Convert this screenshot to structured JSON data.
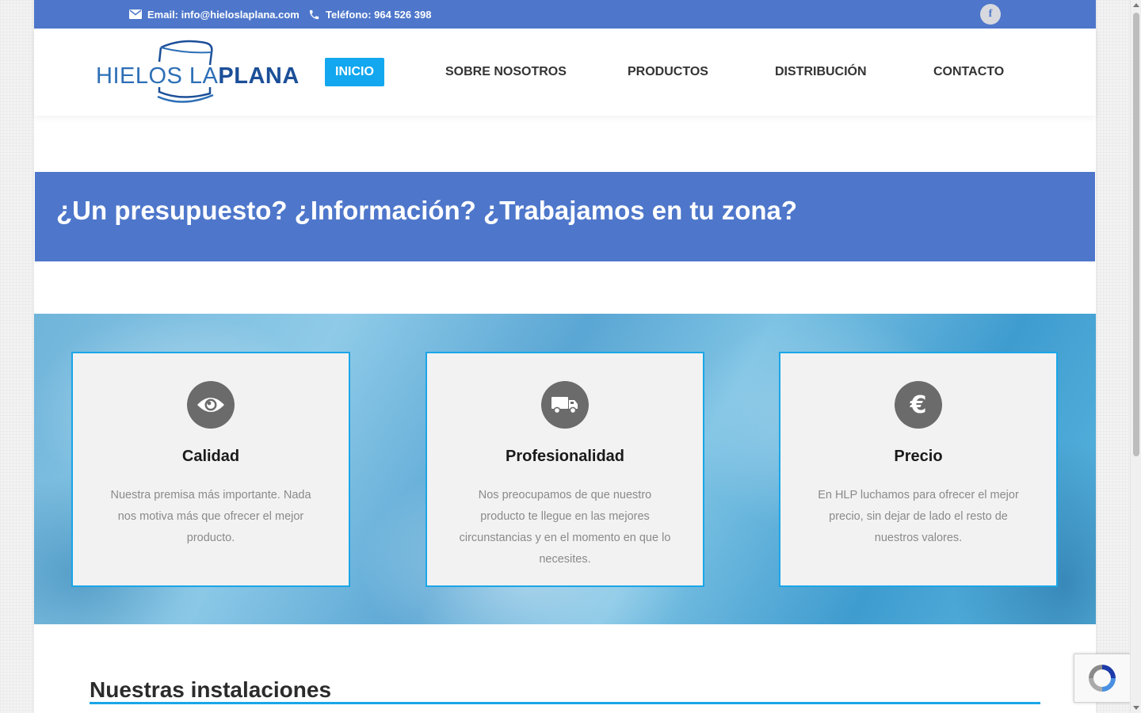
{
  "topbar": {
    "email": "Email: info@hieloslaplana.com",
    "phone": "Teléfono: 964 526 398",
    "facebook_icon": "facebook-icon",
    "background": "#4e77cb"
  },
  "logo": {
    "text_light": "HIELOS LA",
    "text_bold": "PLANA"
  },
  "nav": {
    "items": [
      {
        "label": "INICIO",
        "active": true
      },
      {
        "label": "SOBRE NOSOTROS",
        "active": false
      },
      {
        "label": "PRODUCTOS",
        "active": false
      },
      {
        "label": "DISTRIBUCIÓN",
        "active": false
      },
      {
        "label": "CONTACTO",
        "active": false
      }
    ],
    "active_color": "#12a7ef"
  },
  "cta": {
    "heading": "¿Un presupuesto? ¿Información? ¿Trabajamos en tu zona?"
  },
  "features": [
    {
      "icon": "eye-icon",
      "title": "Calidad",
      "text": "Nuestra premisa más importante. Nada nos motiva más que ofrecer el mejor producto."
    },
    {
      "icon": "truck-icon",
      "title": "Profesionalidad",
      "text": "Nos preocupamos de que nuestro producto te llegue en las mejores circunstancias y en el momento en que lo necesites."
    },
    {
      "icon": "euro-icon",
      "title": "Precio",
      "text": "En HLP luchamos para ofrecer el mejor precio, sin dejar de lado el resto de nuestros valores.",
      "symbol": "€"
    }
  ],
  "installations": {
    "title": "Nuestras instalaciones"
  },
  "colors": {
    "accent": "#1aa6e8",
    "brand_blue": "#4e77cb"
  }
}
